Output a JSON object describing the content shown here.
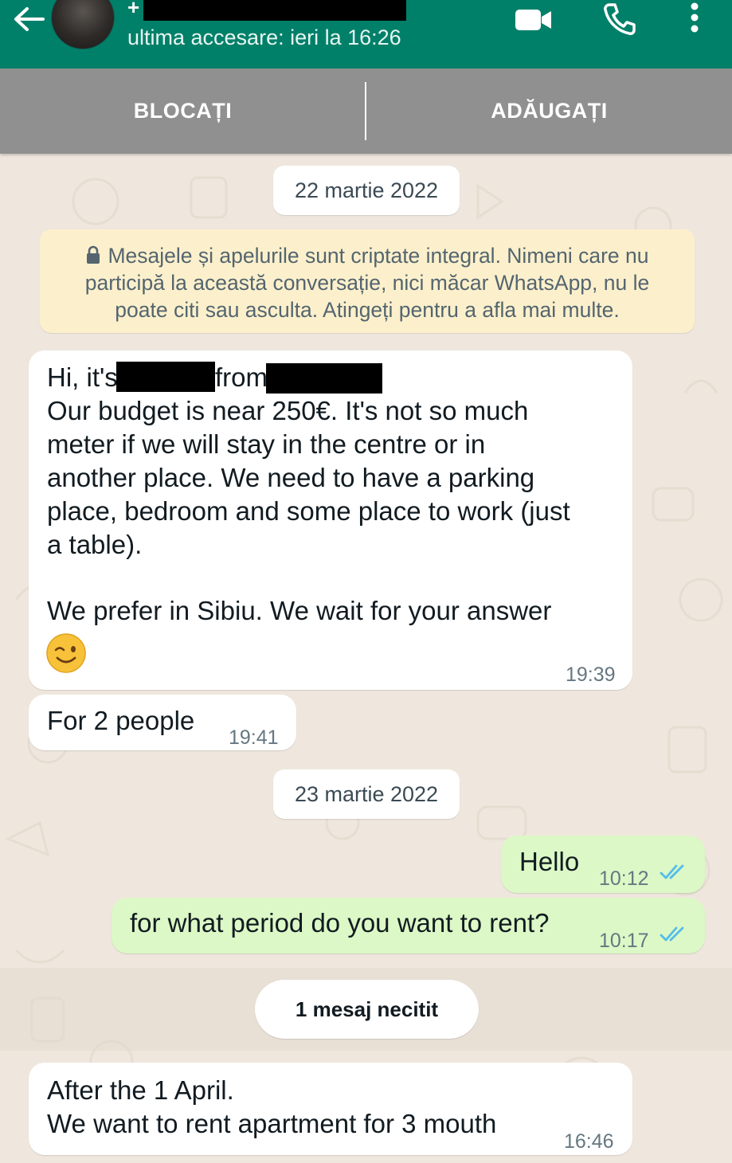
{
  "header": {
    "contact_prefix": "+",
    "last_seen": "ultima accesare: ieri la 16:26",
    "icons": [
      "back-arrow-icon",
      "video-call-icon",
      "voice-call-icon",
      "more-vert-icon"
    ],
    "background": "#008069"
  },
  "actions": {
    "block_label": "BLOCAȚI",
    "add_label": "ADĂUGAȚI"
  },
  "chat": {
    "date_1": "22 martie 2022",
    "date_2": "23 martie 2022",
    "encryption_notice": {
      "line_1": "Mesajele și apelurile sunt criptate integral. Nimeni care nu",
      "line_2": "participă la această conversație, nici măcar WhatsApp, nu le",
      "line_3": "poate citi sau asculta. Atingeți pentru a afla mai multe."
    },
    "messages": [
      {
        "direction": "in",
        "lines": [
          "Hi, it's",
          "from",
          "Our budget is near 250€. It's not so much",
          "meter if we will stay in the centre or in",
          "another place. We need to have a parking",
          "place, bedroom and some place to work (just",
          "a table).",
          "We prefer in Sibiu. We wait for your answer"
        ],
        "emoji": "winking-face",
        "time": "19:39"
      },
      {
        "direction": "in",
        "text": "For 2 people",
        "time": "19:41"
      },
      {
        "direction": "out",
        "text": "Hello",
        "time": "10:12",
        "status": "read"
      },
      {
        "direction": "out",
        "text": "for what period do you want to rent?",
        "time": "10:17",
        "status": "read"
      },
      {
        "direction": "in",
        "lines": [
          "After the 1 April.",
          "We want to rent apartment for 3 mouth"
        ],
        "time": "16:46"
      }
    ],
    "unread_label": "1 mesaj necitit"
  },
  "colors": {
    "incoming_bubble": "#ffffff",
    "outgoing_bubble": "#dcf8c6",
    "read_ticks": "#53bdeb",
    "wallpaper": "#efe7dd",
    "notice_background": "#fcf0cc"
  }
}
